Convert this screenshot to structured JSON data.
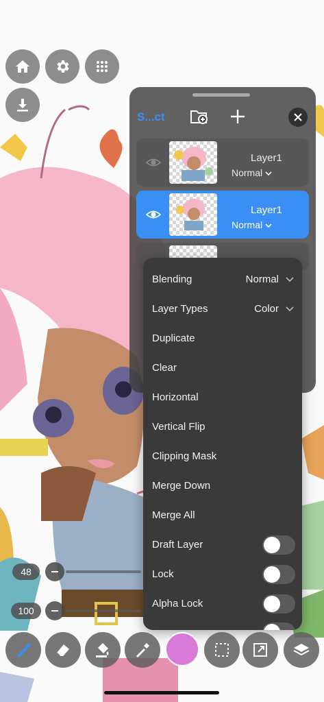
{
  "layers_panel": {
    "title": "S...ct",
    "layers": [
      {
        "name": "Layer1",
        "blend": "Normal",
        "selected": false
      },
      {
        "name": "Layer1",
        "blend": "Normal",
        "selected": true
      }
    ]
  },
  "context_menu": {
    "items": [
      {
        "label": "Blending",
        "value": "Normal",
        "type": "dropdown"
      },
      {
        "label": "Layer Types",
        "value": "Color",
        "type": "dropdown"
      },
      {
        "label": "Duplicate",
        "type": "action"
      },
      {
        "label": "Clear",
        "type": "action"
      },
      {
        "label": "Horizontal",
        "type": "action"
      },
      {
        "label": "Vertical Flip",
        "type": "action"
      },
      {
        "label": "Clipping Mask",
        "type": "action"
      },
      {
        "label": "Merge Down",
        "type": "action"
      },
      {
        "label": "Merge All",
        "type": "action"
      },
      {
        "label": "Draft Layer",
        "type": "toggle",
        "on": false
      },
      {
        "label": "Lock",
        "type": "toggle",
        "on": false
      },
      {
        "label": "Alpha Lock",
        "type": "toggle",
        "on": false
      }
    ]
  },
  "brush": {
    "size": "48",
    "opacity": "100",
    "color": "#d97ad9"
  },
  "icons": {
    "top": [
      "home-icon",
      "gear-icon",
      "grid-icon",
      "download-icon"
    ],
    "toolbar": [
      "brush-icon",
      "eraser-icon",
      "fill-icon",
      "eyedropper-icon",
      "selection-icon",
      "transform-icon",
      "layers-icon"
    ]
  },
  "colors": {
    "accent": "#3a8ff5",
    "panel": "#404040",
    "menu": "#3a3a3a"
  }
}
